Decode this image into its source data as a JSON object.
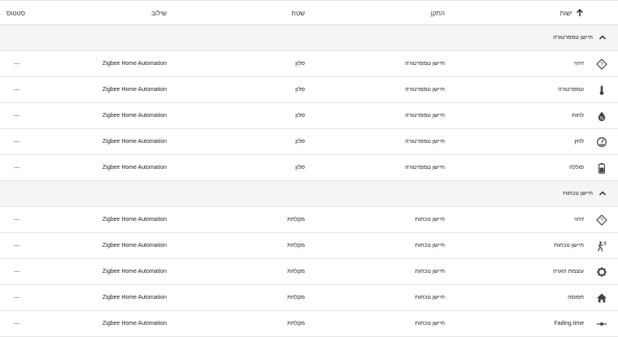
{
  "header": {
    "entity": "ישות",
    "device": "התקן",
    "area": "שטח",
    "integration": "שילוב",
    "status": "סטטוס"
  },
  "groups": [
    {
      "title": "חיישן טמפרטורה",
      "rows": [
        {
          "name": "זיהוי",
          "icon": "help-circle-icon",
          "device": "חיישן טמפרטורה",
          "area": "סלון",
          "integration": "Zigbee Home Automation",
          "status": "—"
        },
        {
          "name": "טמפרטורה",
          "icon": "thermometer-icon",
          "device": "חיישן טמפרטורה",
          "area": "סלון",
          "integration": "Zigbee Home Automation",
          "status": "—"
        },
        {
          "name": "לחות",
          "icon": "water-percent-icon",
          "device": "חיישן טמפרטורה",
          "area": "סלון",
          "integration": "Zigbee Home Automation",
          "status": "—"
        },
        {
          "name": "לחץ",
          "icon": "gauge-icon",
          "device": "חיישן טמפרטורה",
          "area": "סלון",
          "integration": "Zigbee Home Automation",
          "status": "—"
        },
        {
          "name": "סוללה",
          "icon": "battery-icon",
          "device": "חיישן טמפרטורה",
          "area": "סלון",
          "integration": "Zigbee Home Automation",
          "status": "—"
        }
      ]
    },
    {
      "title": "חיישן נוכחות",
      "rows": [
        {
          "name": "זיהוי",
          "icon": "help-circle-icon",
          "device": "חיישן נוכחות",
          "area": "מקלחת",
          "integration": "Zigbee Home Automation",
          "status": "—"
        },
        {
          "name": "חיישן נוכחות",
          "icon": "walk-icon",
          "device": "חיישן נוכחות",
          "area": "מקלחת",
          "integration": "Zigbee Home Automation",
          "status": "—"
        },
        {
          "name": "עוצמת הארה",
          "icon": "brightness-icon",
          "device": "חיישן נוכחות",
          "area": "מקלחת",
          "integration": "Zigbee Home Automation",
          "status": "—"
        },
        {
          "name": "תפוסה",
          "icon": "home-icon",
          "device": "חיישן נוכחות",
          "area": "מקלחת",
          "integration": "Zigbee Home Automation",
          "status": "—"
        },
        {
          "name": "Fading time",
          "icon": "ray-vertex-icon",
          "device": "חיישן נוכחות",
          "area": "מקלחת",
          "integration": "Zigbee Home Automation",
          "status": "—"
        }
      ]
    }
  ]
}
